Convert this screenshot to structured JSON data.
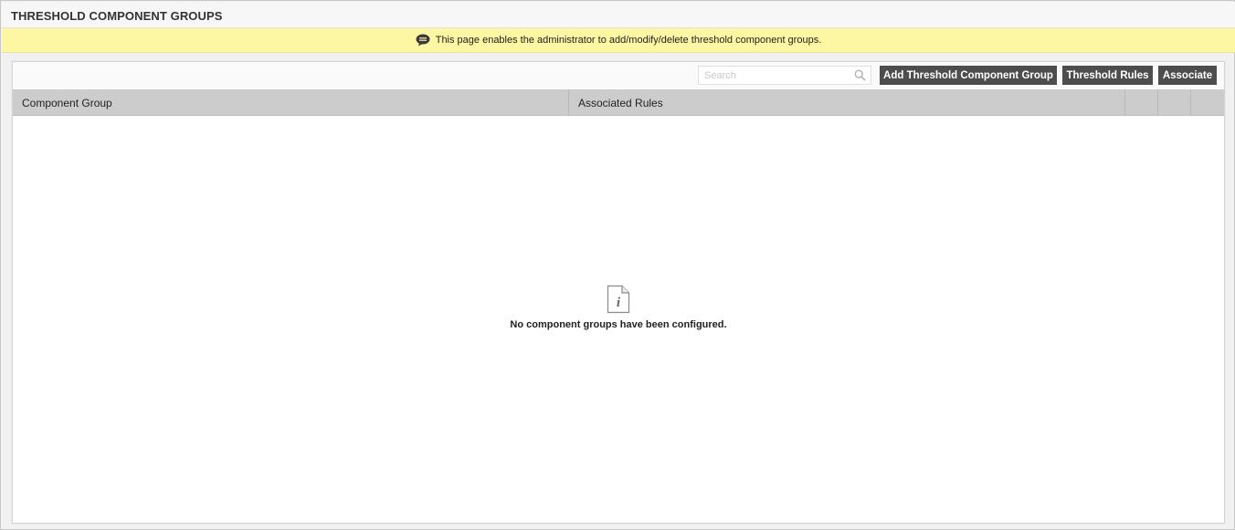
{
  "page": {
    "title": "THRESHOLD COMPONENT GROUPS"
  },
  "info": {
    "icon": "chat-bubble-icon",
    "text": "This page enables the administrator to add/modify/delete threshold component groups."
  },
  "toolbar": {
    "search_placeholder": "Search",
    "search_value": "",
    "search_icon": "search-icon",
    "add_label": "Add Threshold Component Group",
    "rules_label": "Threshold Rules",
    "associate_label": "Associate"
  },
  "table": {
    "columns": [
      "Component Group",
      "Associated Rules",
      "",
      "",
      ""
    ],
    "rows": []
  },
  "empty": {
    "icon": "info-document-icon",
    "message": "No component groups have been configured."
  },
  "colors": {
    "info_bar": "#fdf6a3",
    "button": "#4d4d4d",
    "table_header": "#cccccc"
  }
}
